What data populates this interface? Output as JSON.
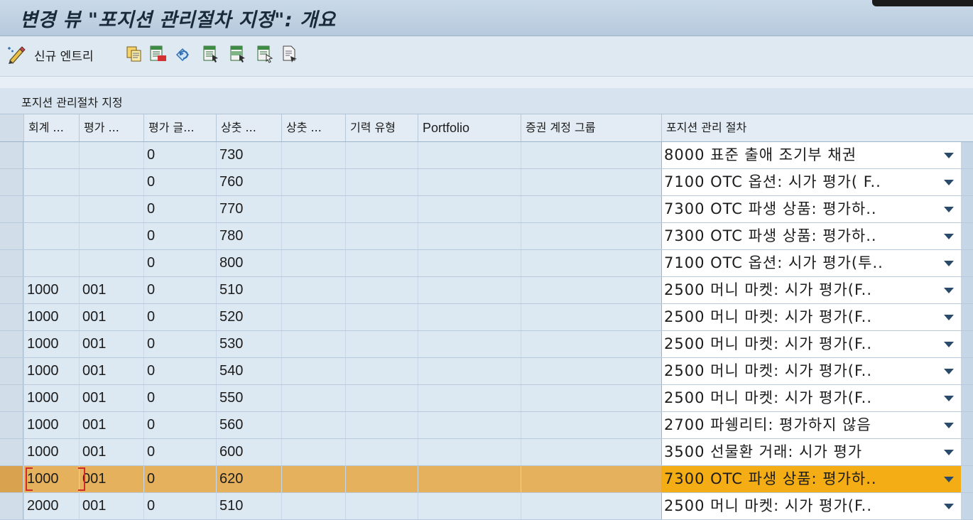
{
  "window": {
    "title": "변경 뷰 \"포지션 관리절차 지정\": 개요"
  },
  "toolbar": {
    "new_entry_label": "신규 엔트리",
    "icons": [
      "edit-pencil-icon",
      "copy-as-icon",
      "delete-icon",
      "undo-change-icon",
      "select-all-icon",
      "select-block-icon",
      "deselect-all-icon",
      "print-icon"
    ]
  },
  "table": {
    "title": "포지션 관리절차 지정",
    "headers": [
      "회계 ...",
      "평가 ...",
      "평가 글...",
      "상춧 ...",
      "상춧 ...",
      "기력 유형",
      "Portfolio",
      "증권 계정 그룹",
      "포지션 관리 절차"
    ],
    "rows": [
      [
        "",
        "",
        "0",
        "730",
        "",
        "",
        "",
        "",
        "8000 표준 출애 조기부 채권"
      ],
      [
        "",
        "",
        "0",
        "760",
        "",
        "",
        "",
        "",
        "7100 OTC 옵션: 시가 평가( F.."
      ],
      [
        "",
        "",
        "0",
        "770",
        "",
        "",
        "",
        "",
        "7300 OTC 파생 상품: 평가하.."
      ],
      [
        "",
        "",
        "0",
        "780",
        "",
        "",
        "",
        "",
        "7300 OTC 파생 상품: 평가하.."
      ],
      [
        "",
        "",
        "0",
        "800",
        "",
        "",
        "",
        "",
        "7100 OTC 옵션: 시가 평가(투.."
      ],
      [
        "1000",
        "001",
        "0",
        "510",
        "",
        "",
        "",
        "",
        "2500 머니 마켓: 시가 평가(F.."
      ],
      [
        "1000",
        "001",
        "0",
        "520",
        "",
        "",
        "",
        "",
        "2500 머니 마켓: 시가 평가(F.."
      ],
      [
        "1000",
        "001",
        "0",
        "530",
        "",
        "",
        "",
        "",
        "2500 머니 마켓: 시가 평가(F.."
      ],
      [
        "1000",
        "001",
        "0",
        "540",
        "",
        "",
        "",
        "",
        "2500 머니 마켓: 시가 평가(F.."
      ],
      [
        "1000",
        "001",
        "0",
        "550",
        "",
        "",
        "",
        "",
        "2500 머니 마켓: 시가 평가(F.."
      ],
      [
        "1000",
        "001",
        "0",
        "560",
        "",
        "",
        "",
        "",
        "2700 파쉥리티: 평가하지 않음"
      ],
      [
        "1000",
        "001",
        "0",
        "600",
        "",
        "",
        "",
        "",
        "3500 선물환 거래: 시가 평가"
      ],
      [
        "1000",
        "001",
        "0",
        "620",
        "",
        "",
        "",
        "",
        "7300 OTC 파생 상품: 평가하.."
      ],
      [
        "2000",
        "001",
        "0",
        "510",
        "",
        "",
        "",
        "",
        "2500 머니 마켓: 시가 평가(F.."
      ]
    ],
    "selected_row": 12
  },
  "colors": {
    "selected_row": "#e5b15c",
    "selected_dropdown": "#f5ad16",
    "focus_marker": "#d12a2a"
  }
}
